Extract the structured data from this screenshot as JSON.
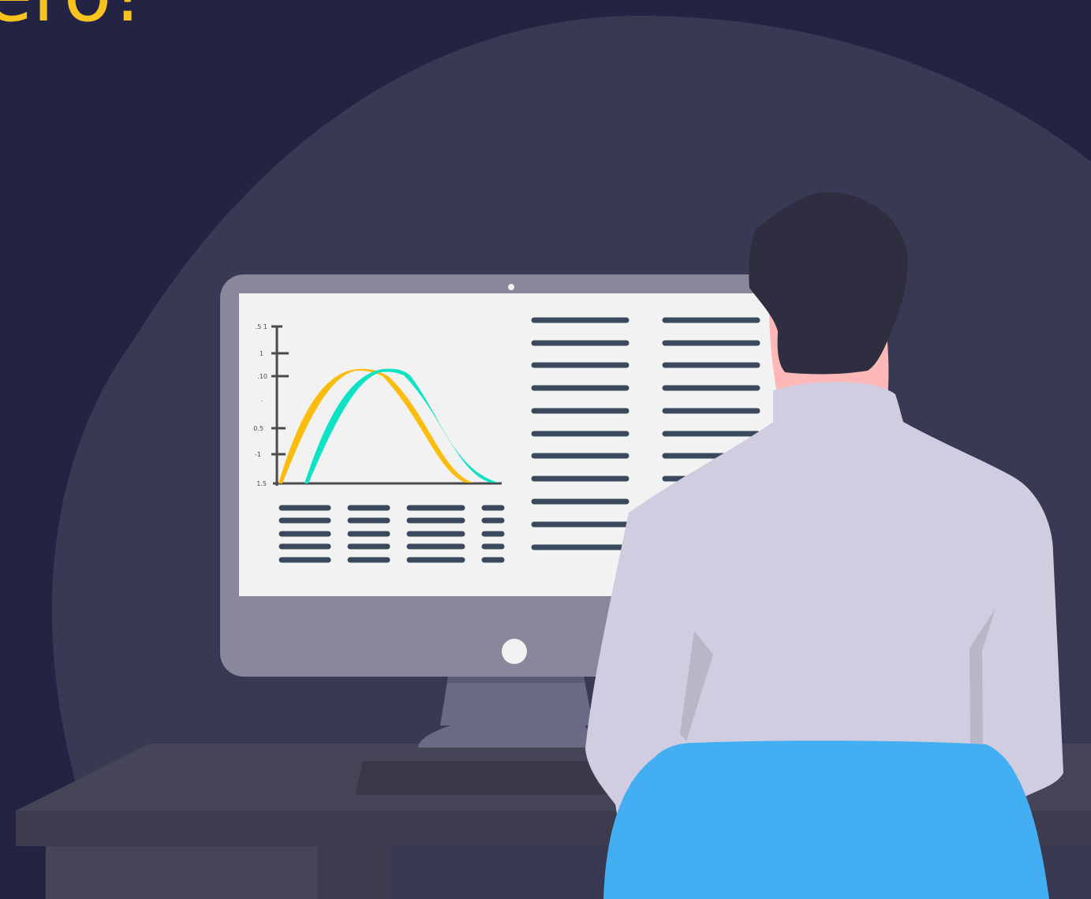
{
  "headline": {
    "text": "ero!"
  },
  "colors": {
    "background": "#232344",
    "spotlight": "#393953",
    "headline": "#f9c31e",
    "monitor_frame": "#88879b",
    "screen": "#f2f2f2",
    "text_line": "#3a4a5c",
    "curve_yellow": "#fcbc0c",
    "curve_teal": "#0de2c4",
    "shirt": "#d0cde1",
    "hair": "#2f2e41",
    "skin": "#ffb8b8",
    "chair": "#44aef2",
    "desk": "#464457"
  },
  "illustration": {
    "figure": "person-at-desk",
    "screen_content": "analytics-dashboard",
    "axis_tick_labels": [
      ".5 1",
      "1",
      ".10",
      ".",
      "0.5",
      "-1",
      "1.5"
    ]
  }
}
